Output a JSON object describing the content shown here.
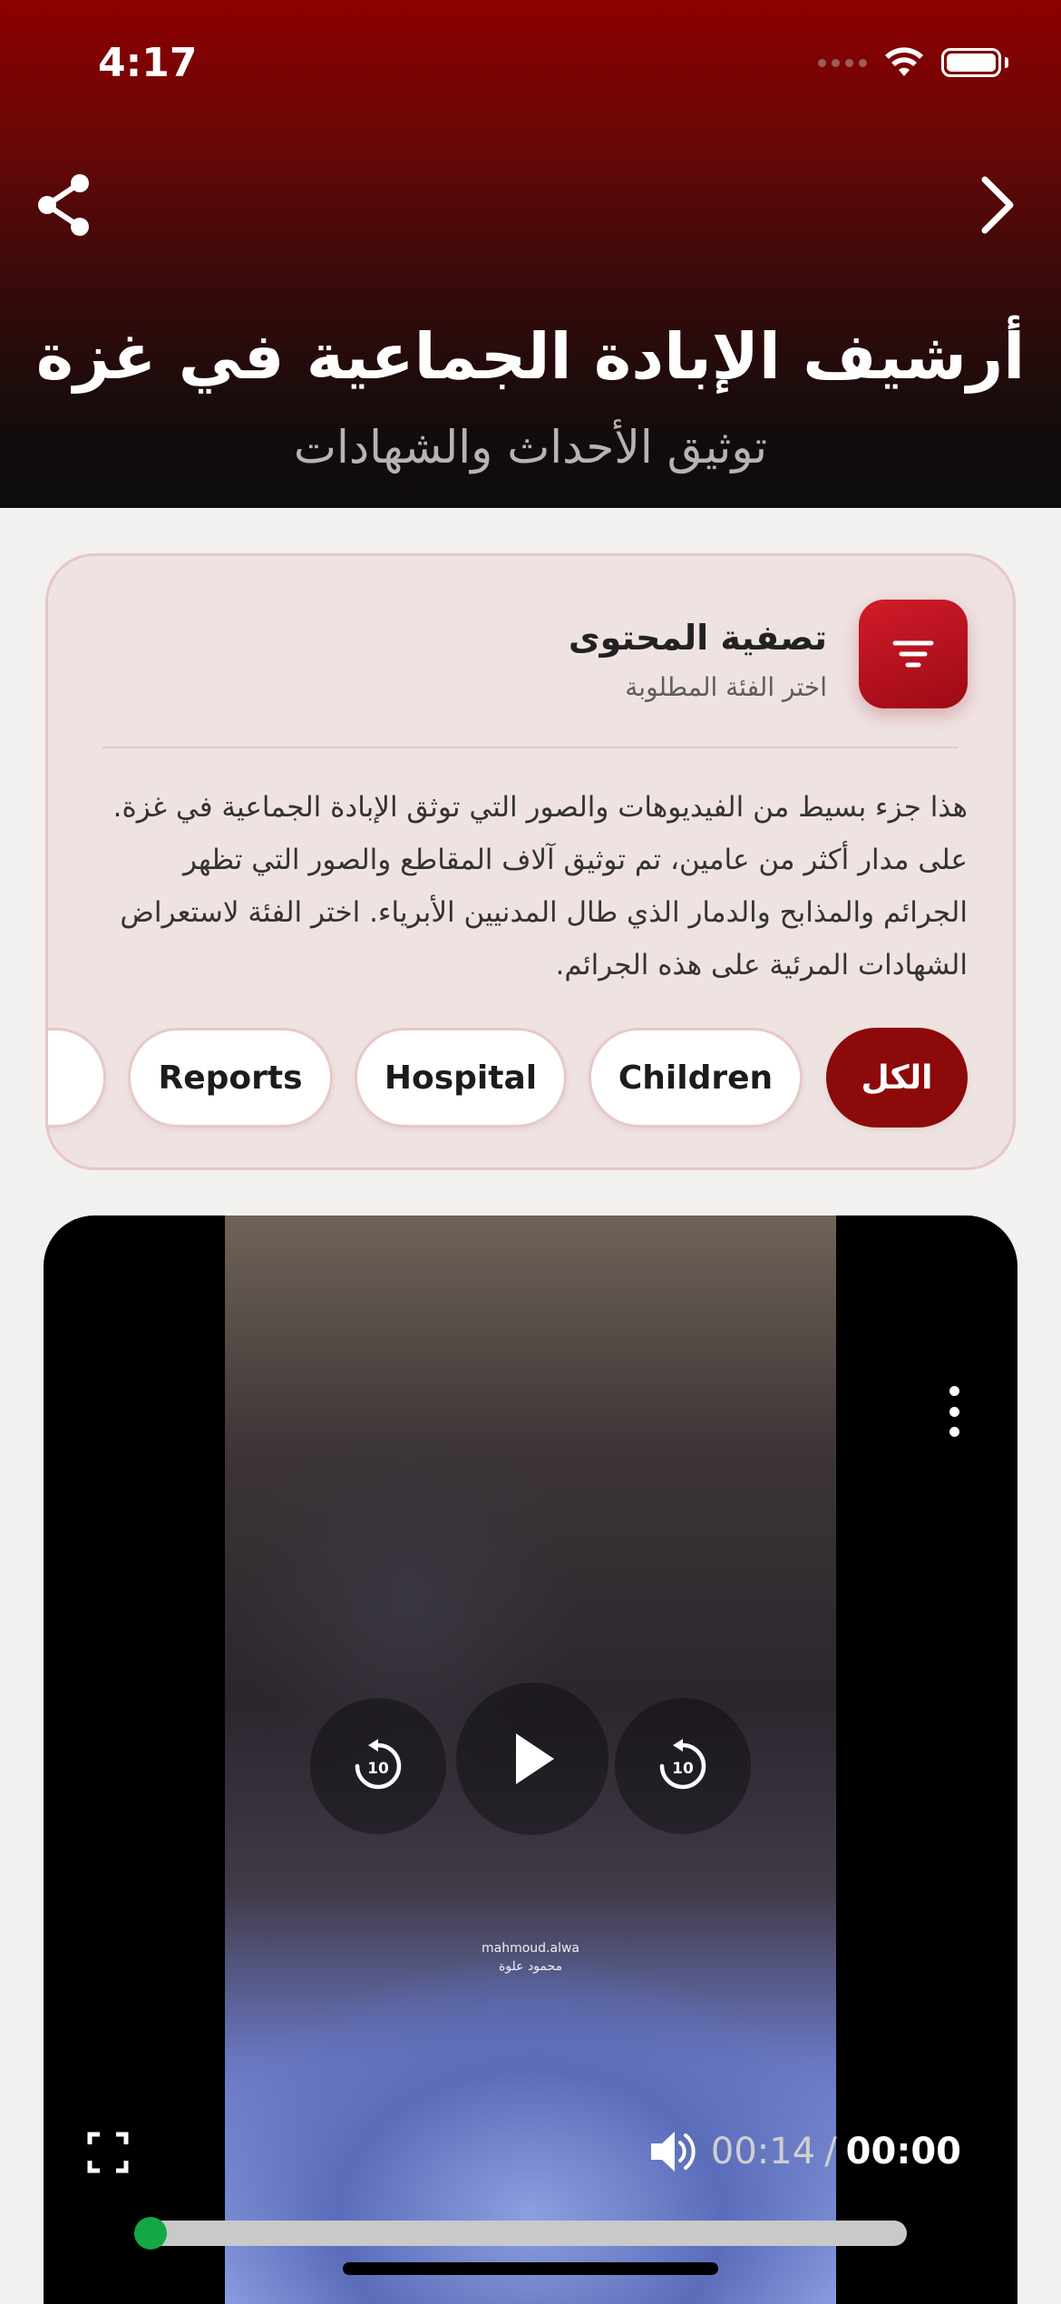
{
  "status_bar": {
    "time": "4:17"
  },
  "header": {
    "title": "أرشيف الإبادة الجماعية في غزة",
    "subtitle": "توثيق الأحداث والشهادات",
    "share_icon": "share-icon",
    "next_icon": "chevron-right-icon"
  },
  "filter": {
    "title": "تصفية المحتوى",
    "subtitle": "اختر الفئة المطلوبة",
    "icon": "filter-icon",
    "description": "هذا جزء بسيط من الفيديوهات والصور التي توثق الإبادة الجماعية في غزة. على مدار أكثر من عامين، تم توثيق آلاف المقاطع والصور التي تظهر الجرائم والمذابح والدمار الذي طال المدنيين الأبرياء. اختر الفئة لاستعراض الشهادات المرئية على هذه الجرائم.",
    "categories": [
      {
        "label": "الكل",
        "active": true
      },
      {
        "label": "Children",
        "active": false
      },
      {
        "label": "Hospital",
        "active": false
      },
      {
        "label": "Reports",
        "active": false
      }
    ]
  },
  "video": {
    "watermark_line1": "mahmoud.alwa",
    "watermark_line2": "محمود علوة",
    "rewind_seconds": "10",
    "forward_seconds": "10",
    "current_time": "00:14",
    "separator": "/",
    "total_time": "00:00",
    "progress": 0.0,
    "accent_color": "#13a745"
  },
  "colors": {
    "brand": "#8d0a0a",
    "header_top": "#8d0000"
  }
}
